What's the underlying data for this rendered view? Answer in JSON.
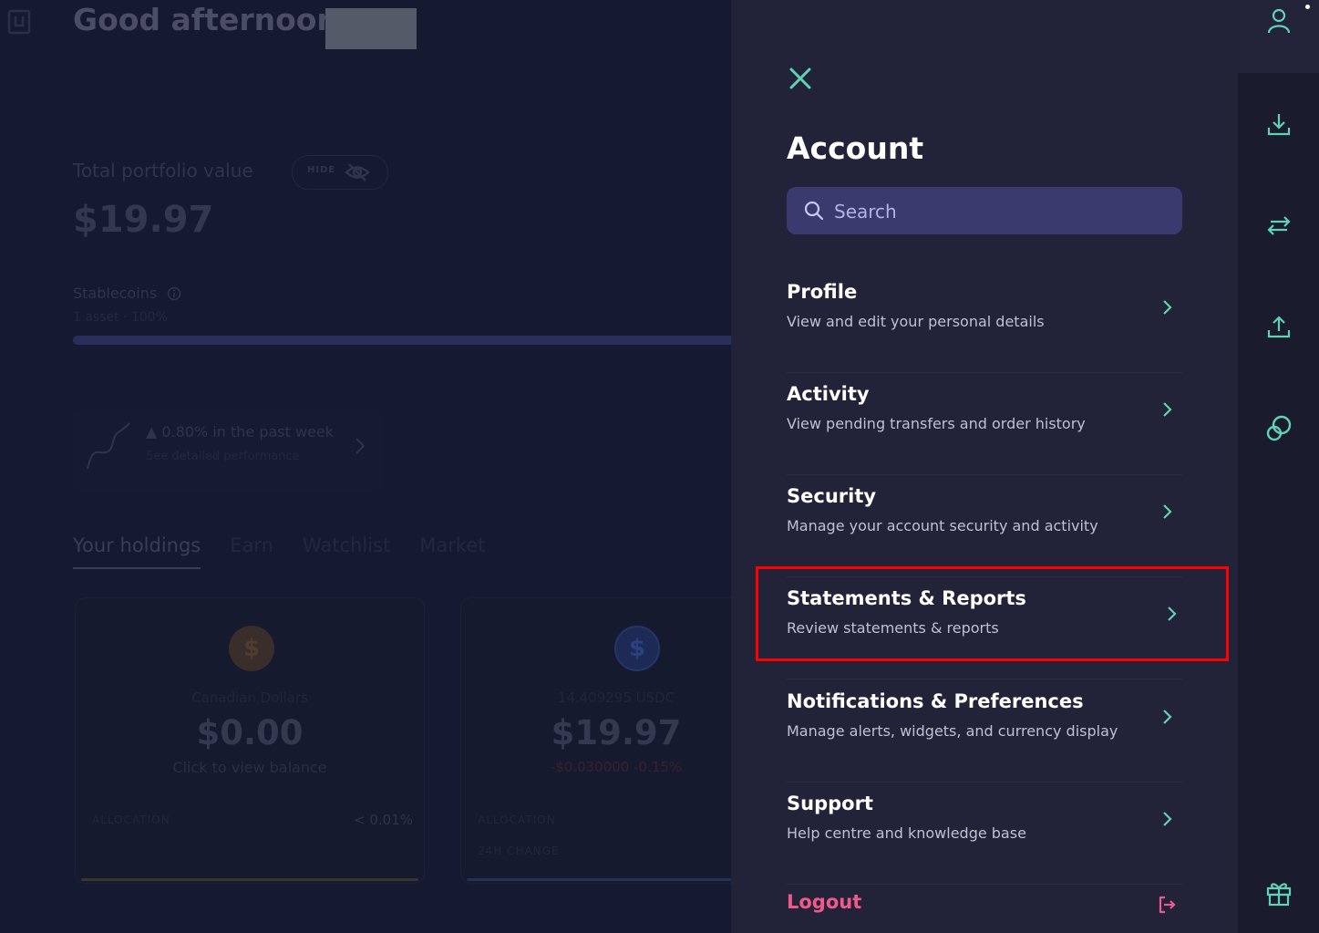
{
  "dashboard": {
    "greeting": "Good afternoon,",
    "portfolio": {
      "label": "Total portfolio value",
      "hide_label": "HIDE",
      "value": "$19.97",
      "stablecoins_label": "Stablecoins",
      "stablecoins_sub": "1 asset · 100%",
      "allocation_fraction": 1.0
    },
    "performance": {
      "title": "▲ 0.80% in the past week",
      "subtitle": "See detailed performance"
    },
    "tabs": [
      "Your holdings",
      "Earn",
      "Watchlist",
      "Market"
    ],
    "active_tab": "Your holdings",
    "holdings": [
      {
        "coin_symbol": "$",
        "name": "Canadian Dollars",
        "value": "$0.00",
        "sub": "Click to view balance",
        "allocation_label": "ALLOCATION",
        "allocation_value": "< 0.01%"
      },
      {
        "coin_symbol": "$",
        "name": "14.409295 USDC",
        "value": "$19.97",
        "sub": "-$0.030000  -0.15%",
        "allocation_label": "ALLOCATION",
        "change_label": "24H CHANGE"
      }
    ]
  },
  "account": {
    "title": "Account",
    "search_placeholder": "Search",
    "items": [
      {
        "title": "Profile",
        "description": "View and edit your personal details"
      },
      {
        "title": "Activity",
        "description": "View pending transfers and order history"
      },
      {
        "title": "Security",
        "description": "Manage your account security and activity"
      },
      {
        "title": "Statements & Reports",
        "description": "Review statements & reports"
      },
      {
        "title": "Notifications & Preferences",
        "description": "Manage alerts, widgets, and currency display"
      },
      {
        "title": "Support",
        "description": "Help centre and knowledge base"
      }
    ],
    "highlighted_item": "Statements & Reports",
    "logout_label": "Logout"
  },
  "rail": {
    "icons": [
      "user-icon",
      "download-icon",
      "transfer-icon",
      "upload-icon",
      "loop-icon",
      "gift-icon"
    ]
  },
  "colors": {
    "accent_teal": "#5fd3b4",
    "logout_pink": "#ef5a8a",
    "highlight_red": "#ff0000",
    "drawer_bg": "#222238"
  }
}
